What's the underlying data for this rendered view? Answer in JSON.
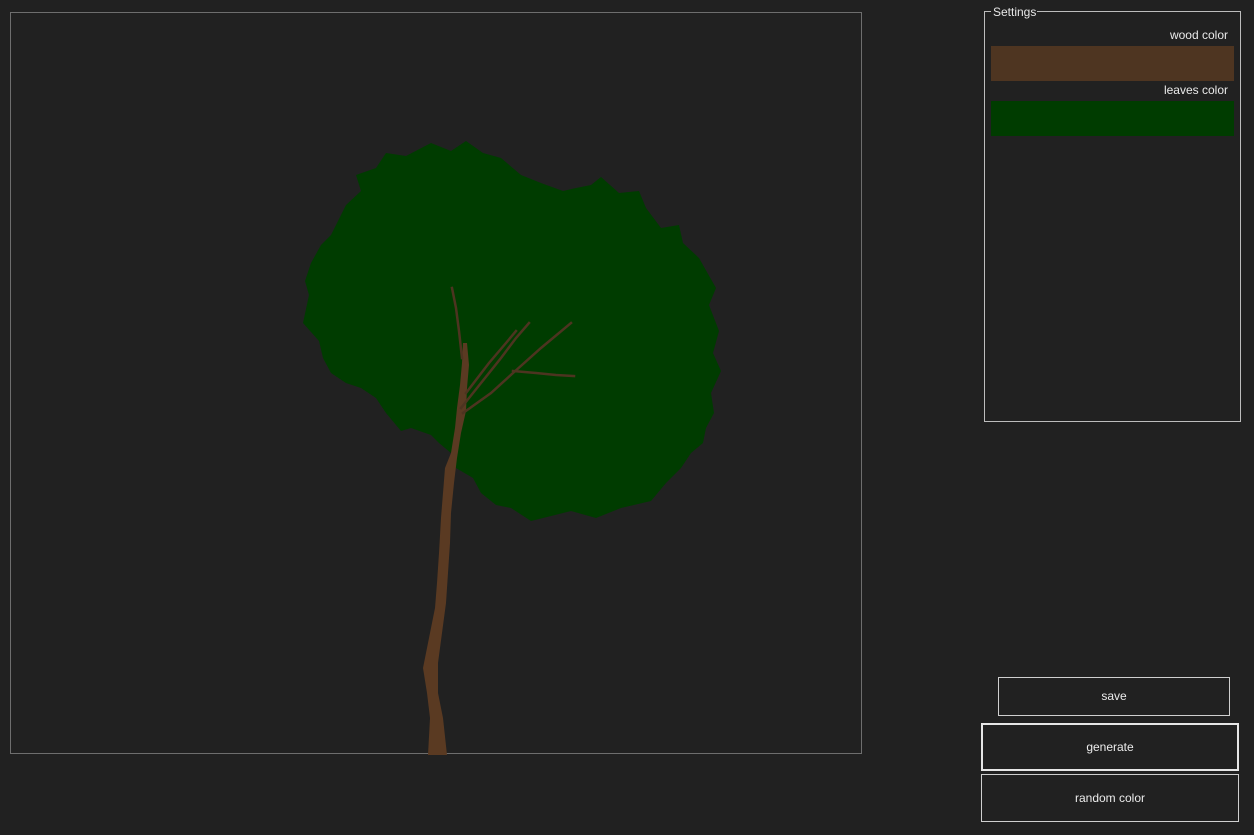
{
  "canvas": {
    "wood_color": "#4d3420",
    "leaves_color": "#003c00",
    "trunk_color": "#5a3a22",
    "background": "#212121"
  },
  "settings": {
    "legend": "Settings",
    "wood_color_label": "wood color",
    "wood_color_value": "#4e3521",
    "leaves_color_label": "leaves color",
    "leaves_color_value": "#003c00"
  },
  "buttons": {
    "save": "save",
    "generate": "generate",
    "random_color": "random color"
  }
}
